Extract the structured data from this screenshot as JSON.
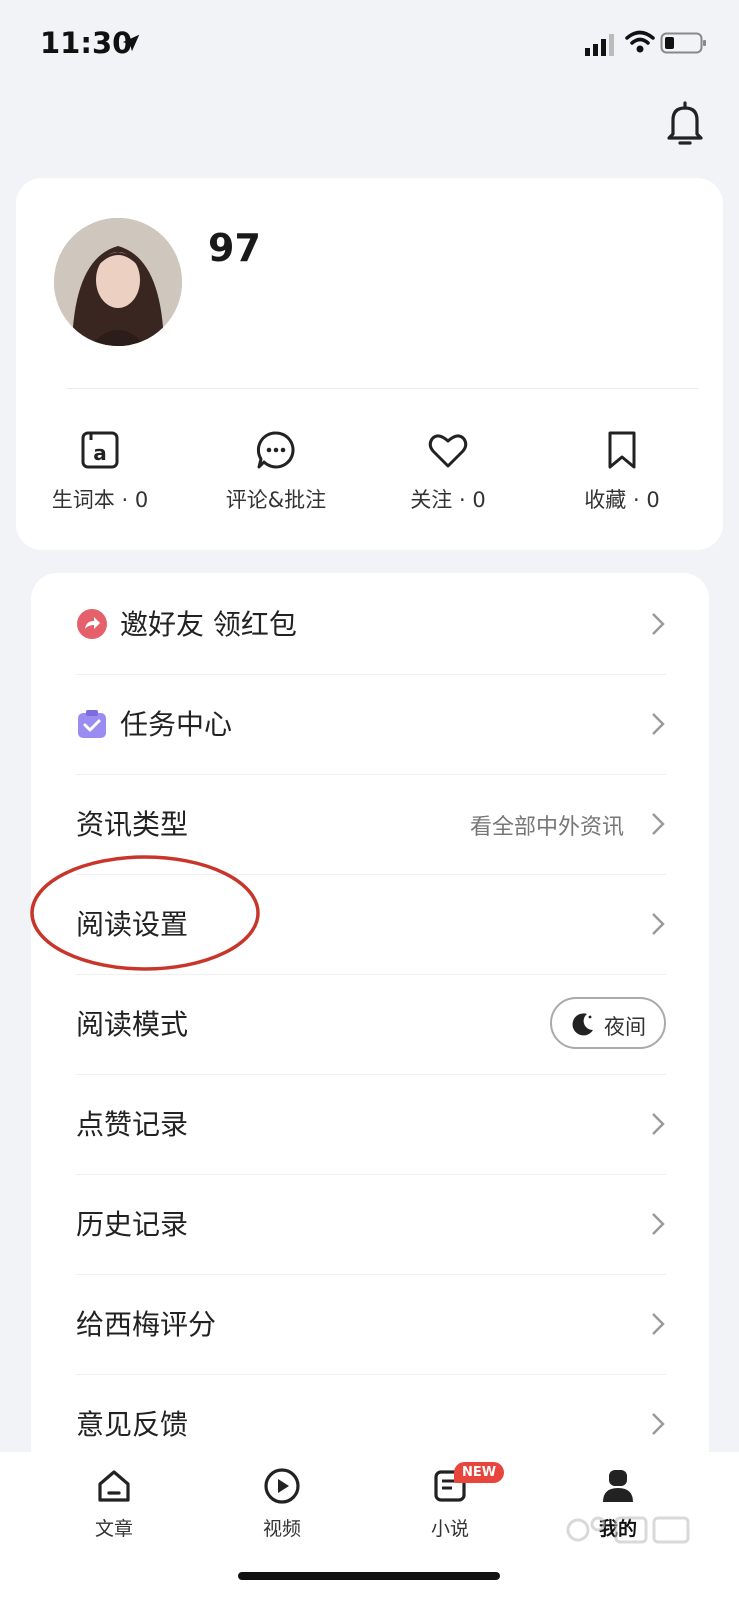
{
  "status_bar": {
    "time": "11:30"
  },
  "profile": {
    "username": "97"
  },
  "stats": [
    {
      "label": "生词本 · 0",
      "icon": "vocabulary-book-icon"
    },
    {
      "label": "评论&批注",
      "icon": "comment-bubble-icon"
    },
    {
      "label": "关注 · 0",
      "icon": "heart-icon"
    },
    {
      "label": "收藏 · 0",
      "icon": "bookmark-icon"
    }
  ],
  "menu": [
    {
      "label": "邀好友 领红包",
      "icon": "invite-share-icon"
    },
    {
      "label": "任务中心",
      "icon": "task-clipboard-icon"
    },
    {
      "label": "资讯类型",
      "value": "看全部中外资讯"
    },
    {
      "label": "阅读设置"
    },
    {
      "label": "阅读模式",
      "toggle_label": "夜间"
    },
    {
      "label": "点赞记录"
    },
    {
      "label": "历史记录"
    },
    {
      "label": "给西梅评分"
    },
    {
      "label": "意见反馈"
    }
  ],
  "tabs": [
    {
      "label": "文章",
      "icon": "home-icon"
    },
    {
      "label": "视频",
      "icon": "play-circle-icon"
    },
    {
      "label": "小说",
      "icon": "novel-doc-icon",
      "badge": "NEW"
    },
    {
      "label": "我的",
      "icon": "user-profile-icon",
      "active": true
    }
  ],
  "colors": {
    "background": "#f1f3f7",
    "annotation_red": "#c8362b",
    "badge_red": "#e8453c",
    "task_icon_purple": "#9b8cf2",
    "invite_icon_red": "#e5606b"
  }
}
